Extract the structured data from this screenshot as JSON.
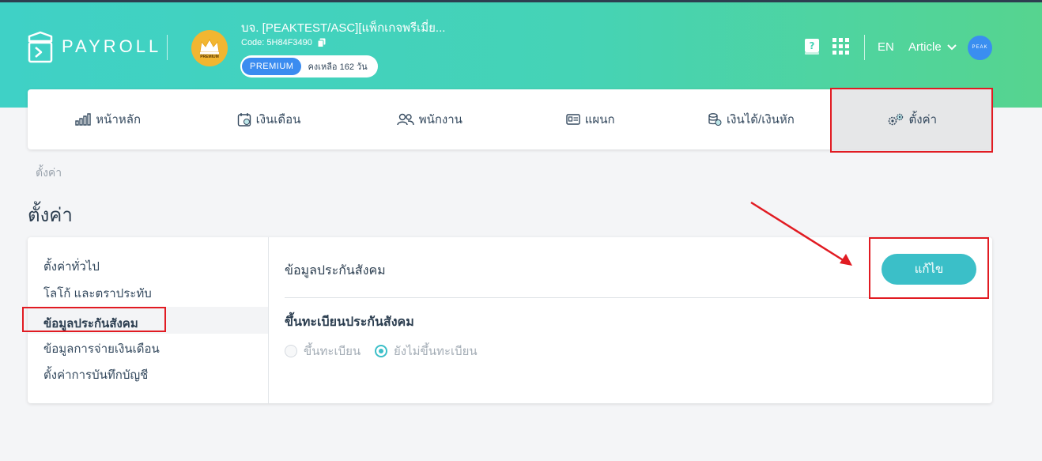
{
  "app": {
    "logo_text": "PAYROLL",
    "company_name": "บจ. [PEAKTEST/ASC][แพ็กเกจพรีเมี่ย...",
    "company_code": "Code: 5H84F3490",
    "plan_badge": "PREMIUM",
    "plan_remaining": "คงเหลือ 162 วัน",
    "badge_caption": "PREMIUM",
    "language": "EN",
    "user_name": "Article",
    "avatar_text": "PEAK"
  },
  "nav": {
    "items": [
      {
        "label": "หน้าหลัก",
        "icon": "chart-bars-icon"
      },
      {
        "label": "เงินเดือน",
        "icon": "calendar-money-icon"
      },
      {
        "label": "พนักงาน",
        "icon": "people-icon"
      },
      {
        "label": "แผนก",
        "icon": "id-card-icon"
      },
      {
        "label": "เงินได้/เงินหัก",
        "icon": "coins-icon"
      },
      {
        "label": "ตั้งค่า",
        "icon": "gears-icon"
      }
    ],
    "active_index": 5
  },
  "breadcrumb": "ตั้งค่า",
  "page_title": "ตั้งค่า",
  "sidebar": {
    "items": [
      {
        "label": "ตั้งค่าทั่วไป"
      },
      {
        "label": "โลโก้ และตราประทับ"
      },
      {
        "label": "ข้อมูลประกันสังคม"
      },
      {
        "label": "ข้อมูลการจ่ายเงินเดือน"
      },
      {
        "label": "ตั้งค่าการบันทึกบัญชี"
      }
    ],
    "active_index": 2
  },
  "content": {
    "section_title": "ข้อมูลประกันสังคม",
    "edit_label": "แก้ไข",
    "sub_title": "ขึ้นทะเบียนประกันสังคม",
    "radio_options": [
      {
        "label": "ขึ้นทะเบียน",
        "checked": false
      },
      {
        "label": "ยังไม่ขึ้นทะเบียน",
        "checked": true
      }
    ]
  },
  "colors": {
    "header_gradient_start": "#3fd1c6",
    "header_gradient_end": "#56d48f",
    "accent": "#3bbfc8",
    "premium_badge": "#3b8cf0",
    "annotation_red": "#e11b22"
  }
}
